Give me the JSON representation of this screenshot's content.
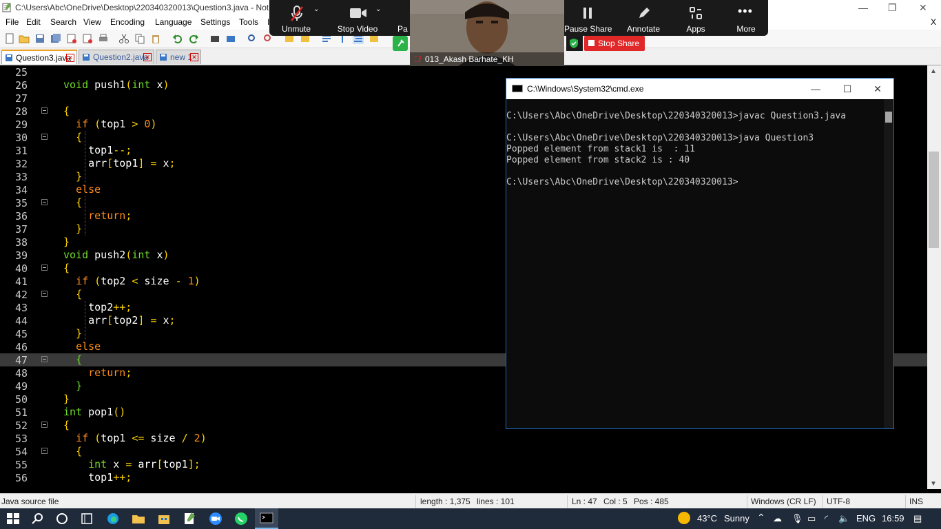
{
  "notepad": {
    "title": "C:\\Users\\Abc\\OneDrive\\Desktop\\220340320013\\Question3.java - Note",
    "menu": [
      "File",
      "Edit",
      "Search",
      "View",
      "Encoding",
      "Language",
      "Settings",
      "Tools",
      "I"
    ],
    "close_x": "X",
    "tabs": [
      {
        "label": "Question3.java",
        "active": true
      },
      {
        "label": "Question2.java",
        "active": false
      },
      {
        "label": "new 1",
        "active": false
      }
    ],
    "colors": {
      "keyword": "#6fdc2a",
      "control": "#ff8c1a",
      "brace": "#ffd400",
      "number": "#ff8c1a",
      "operator": "#ffd400"
    }
  },
  "code_lines": [
    {
      "n": "25",
      "tokens": [],
      "fold": false
    },
    {
      "n": "26",
      "tokens": [
        [
          "k",
          "void"
        ],
        [
          "p",
          " push1"
        ],
        [
          "o",
          "("
        ],
        [
          "k",
          "int"
        ],
        [
          "p",
          " x"
        ],
        [
          "o",
          ")"
        ]
      ],
      "fold": false
    },
    {
      "n": "27",
      "tokens": [],
      "fold": false
    },
    {
      "n": "28",
      "tokens": [
        [
          "b",
          "{"
        ]
      ],
      "fold": true
    },
    {
      "n": "29",
      "tokens": [
        [
          "p",
          "  "
        ],
        [
          "c",
          "if"
        ],
        [
          "p",
          " "
        ],
        [
          "o",
          "("
        ],
        [
          "p",
          "top1 "
        ],
        [
          "o",
          ">"
        ],
        [
          "p",
          " "
        ],
        [
          "num",
          "0"
        ],
        [
          "o",
          ")"
        ]
      ],
      "fold": false
    },
    {
      "n": "30",
      "tokens": [
        [
          "p",
          "  "
        ],
        [
          "b",
          "{"
        ]
      ],
      "fold": true
    },
    {
      "n": "31",
      "tokens": [
        [
          "p",
          "    top1"
        ],
        [
          "o",
          "--;"
        ]
      ],
      "fold": false
    },
    {
      "n": "32",
      "tokens": [
        [
          "p",
          "    arr"
        ],
        [
          "o",
          "["
        ],
        [
          "p",
          "top1"
        ],
        [
          "o",
          "]"
        ],
        [
          "p",
          " "
        ],
        [
          "o",
          "="
        ],
        [
          "p",
          " x"
        ],
        [
          "o",
          ";"
        ]
      ],
      "fold": false
    },
    {
      "n": "33",
      "tokens": [
        [
          "p",
          "  "
        ],
        [
          "b",
          "}"
        ]
      ],
      "fold": false
    },
    {
      "n": "34",
      "tokens": [
        [
          "p",
          "  "
        ],
        [
          "c",
          "else"
        ]
      ],
      "fold": false
    },
    {
      "n": "35",
      "tokens": [
        [
          "p",
          "  "
        ],
        [
          "b",
          "{"
        ]
      ],
      "fold": true
    },
    {
      "n": "36",
      "tokens": [
        [
          "p",
          "    "
        ],
        [
          "c",
          "return"
        ],
        [
          "o",
          ";"
        ]
      ],
      "fold": false
    },
    {
      "n": "37",
      "tokens": [
        [
          "p",
          "  "
        ],
        [
          "b",
          "}"
        ]
      ],
      "fold": false
    },
    {
      "n": "38",
      "tokens": [
        [
          "b",
          "}"
        ]
      ],
      "fold": false
    },
    {
      "n": "39",
      "tokens": [
        [
          "k",
          "void"
        ],
        [
          "p",
          " push2"
        ],
        [
          "o",
          "("
        ],
        [
          "k",
          "int"
        ],
        [
          "p",
          " x"
        ],
        [
          "o",
          ")"
        ]
      ],
      "fold": false
    },
    {
      "n": "40",
      "tokens": [
        [
          "b",
          "{"
        ]
      ],
      "fold": true
    },
    {
      "n": "41",
      "tokens": [
        [
          "p",
          "  "
        ],
        [
          "c",
          "if"
        ],
        [
          "p",
          " "
        ],
        [
          "o",
          "("
        ],
        [
          "p",
          "top2 "
        ],
        [
          "o",
          "<"
        ],
        [
          "p",
          " size "
        ],
        [
          "o",
          "-"
        ],
        [
          "p",
          " "
        ],
        [
          "num",
          "1"
        ],
        [
          "o",
          ")"
        ]
      ],
      "fold": false
    },
    {
      "n": "42",
      "tokens": [
        [
          "p",
          "  "
        ],
        [
          "b",
          "{"
        ]
      ],
      "fold": true
    },
    {
      "n": "43",
      "tokens": [
        [
          "p",
          "    top2"
        ],
        [
          "o",
          "++;"
        ]
      ],
      "fold": false
    },
    {
      "n": "44",
      "tokens": [
        [
          "p",
          "    arr"
        ],
        [
          "o",
          "["
        ],
        [
          "p",
          "top2"
        ],
        [
          "o",
          "]"
        ],
        [
          "p",
          " "
        ],
        [
          "o",
          "="
        ],
        [
          "p",
          " x"
        ],
        [
          "o",
          ";"
        ]
      ],
      "fold": false
    },
    {
      "n": "45",
      "tokens": [
        [
          "p",
          "  "
        ],
        [
          "b",
          "}"
        ]
      ],
      "fold": false
    },
    {
      "n": "46",
      "tokens": [
        [
          "p",
          "  "
        ],
        [
          "c",
          "else"
        ]
      ],
      "fold": false
    },
    {
      "n": "47",
      "tokens": [
        [
          "p",
          "  "
        ],
        [
          "g",
          "{"
        ]
      ],
      "fold": true,
      "current": true
    },
    {
      "n": "48",
      "tokens": [
        [
          "p",
          "    "
        ],
        [
          "c",
          "return"
        ],
        [
          "o",
          ";"
        ]
      ],
      "fold": false
    },
    {
      "n": "49",
      "tokens": [
        [
          "p",
          "  "
        ],
        [
          "g",
          "}"
        ]
      ],
      "fold": false
    },
    {
      "n": "50",
      "tokens": [
        [
          "b",
          "}"
        ]
      ],
      "fold": false
    },
    {
      "n": "51",
      "tokens": [
        [
          "k",
          "int"
        ],
        [
          "p",
          " pop1"
        ],
        [
          "o",
          "()"
        ]
      ],
      "fold": false
    },
    {
      "n": "52",
      "tokens": [
        [
          "b",
          "{"
        ]
      ],
      "fold": true
    },
    {
      "n": "53",
      "tokens": [
        [
          "p",
          "  "
        ],
        [
          "c",
          "if"
        ],
        [
          "p",
          " "
        ],
        [
          "o",
          "("
        ],
        [
          "p",
          "top1 "
        ],
        [
          "o",
          "<="
        ],
        [
          "p",
          " size "
        ],
        [
          "o",
          "/"
        ],
        [
          "p",
          " "
        ],
        [
          "num",
          "2"
        ],
        [
          "o",
          ")"
        ]
      ],
      "fold": false
    },
    {
      "n": "54",
      "tokens": [
        [
          "p",
          "  "
        ],
        [
          "b",
          "{"
        ]
      ],
      "fold": true
    },
    {
      "n": "55",
      "tokens": [
        [
          "p",
          "    "
        ],
        [
          "k",
          "int"
        ],
        [
          "p",
          " x "
        ],
        [
          "o",
          "="
        ],
        [
          "p",
          " arr"
        ],
        [
          "o",
          "["
        ],
        [
          "p",
          "top1"
        ],
        [
          "o",
          "];"
        ]
      ],
      "fold": false
    },
    {
      "n": "56",
      "tokens": [
        [
          "p",
          "    top1"
        ],
        [
          "o",
          "++;"
        ]
      ],
      "fold": false
    }
  ],
  "status": {
    "file_type": "Java source file",
    "length": "length : 1,375",
    "lines": "lines : 101",
    "ln": "Ln : 47",
    "col": "Col : 5",
    "pos": "Pos : 485",
    "eol": "Windows (CR LF)",
    "encoding": "UTF-8",
    "mode": "INS"
  },
  "cmd": {
    "title": "C:\\Windows\\System32\\cmd.exe",
    "lines": [
      "C:\\Users\\Abc\\OneDrive\\Desktop\\220340320013>javac Question3.java",
      "",
      "C:\\Users\\Abc\\OneDrive\\Desktop\\220340320013>java Question3",
      "Popped element from stack1 is  : 11",
      "Popped element from stack2 is : 40",
      "",
      "C:\\Users\\Abc\\OneDrive\\Desktop\\220340320013>"
    ]
  },
  "zoom": {
    "unmute": "Unmute",
    "stop_video": "Stop Video",
    "participants_partial": "Pa",
    "pause_share": "Pause Share",
    "annotate": "Annotate",
    "apps": "Apps",
    "more": "More",
    "stop_share": "Stop Share",
    "participant_name": "013_Akash Barhate_KH"
  },
  "taskbar": {
    "weather_temp": "43°C",
    "weather_text": "Sunny",
    "language": "ENG",
    "time": "16:59"
  }
}
